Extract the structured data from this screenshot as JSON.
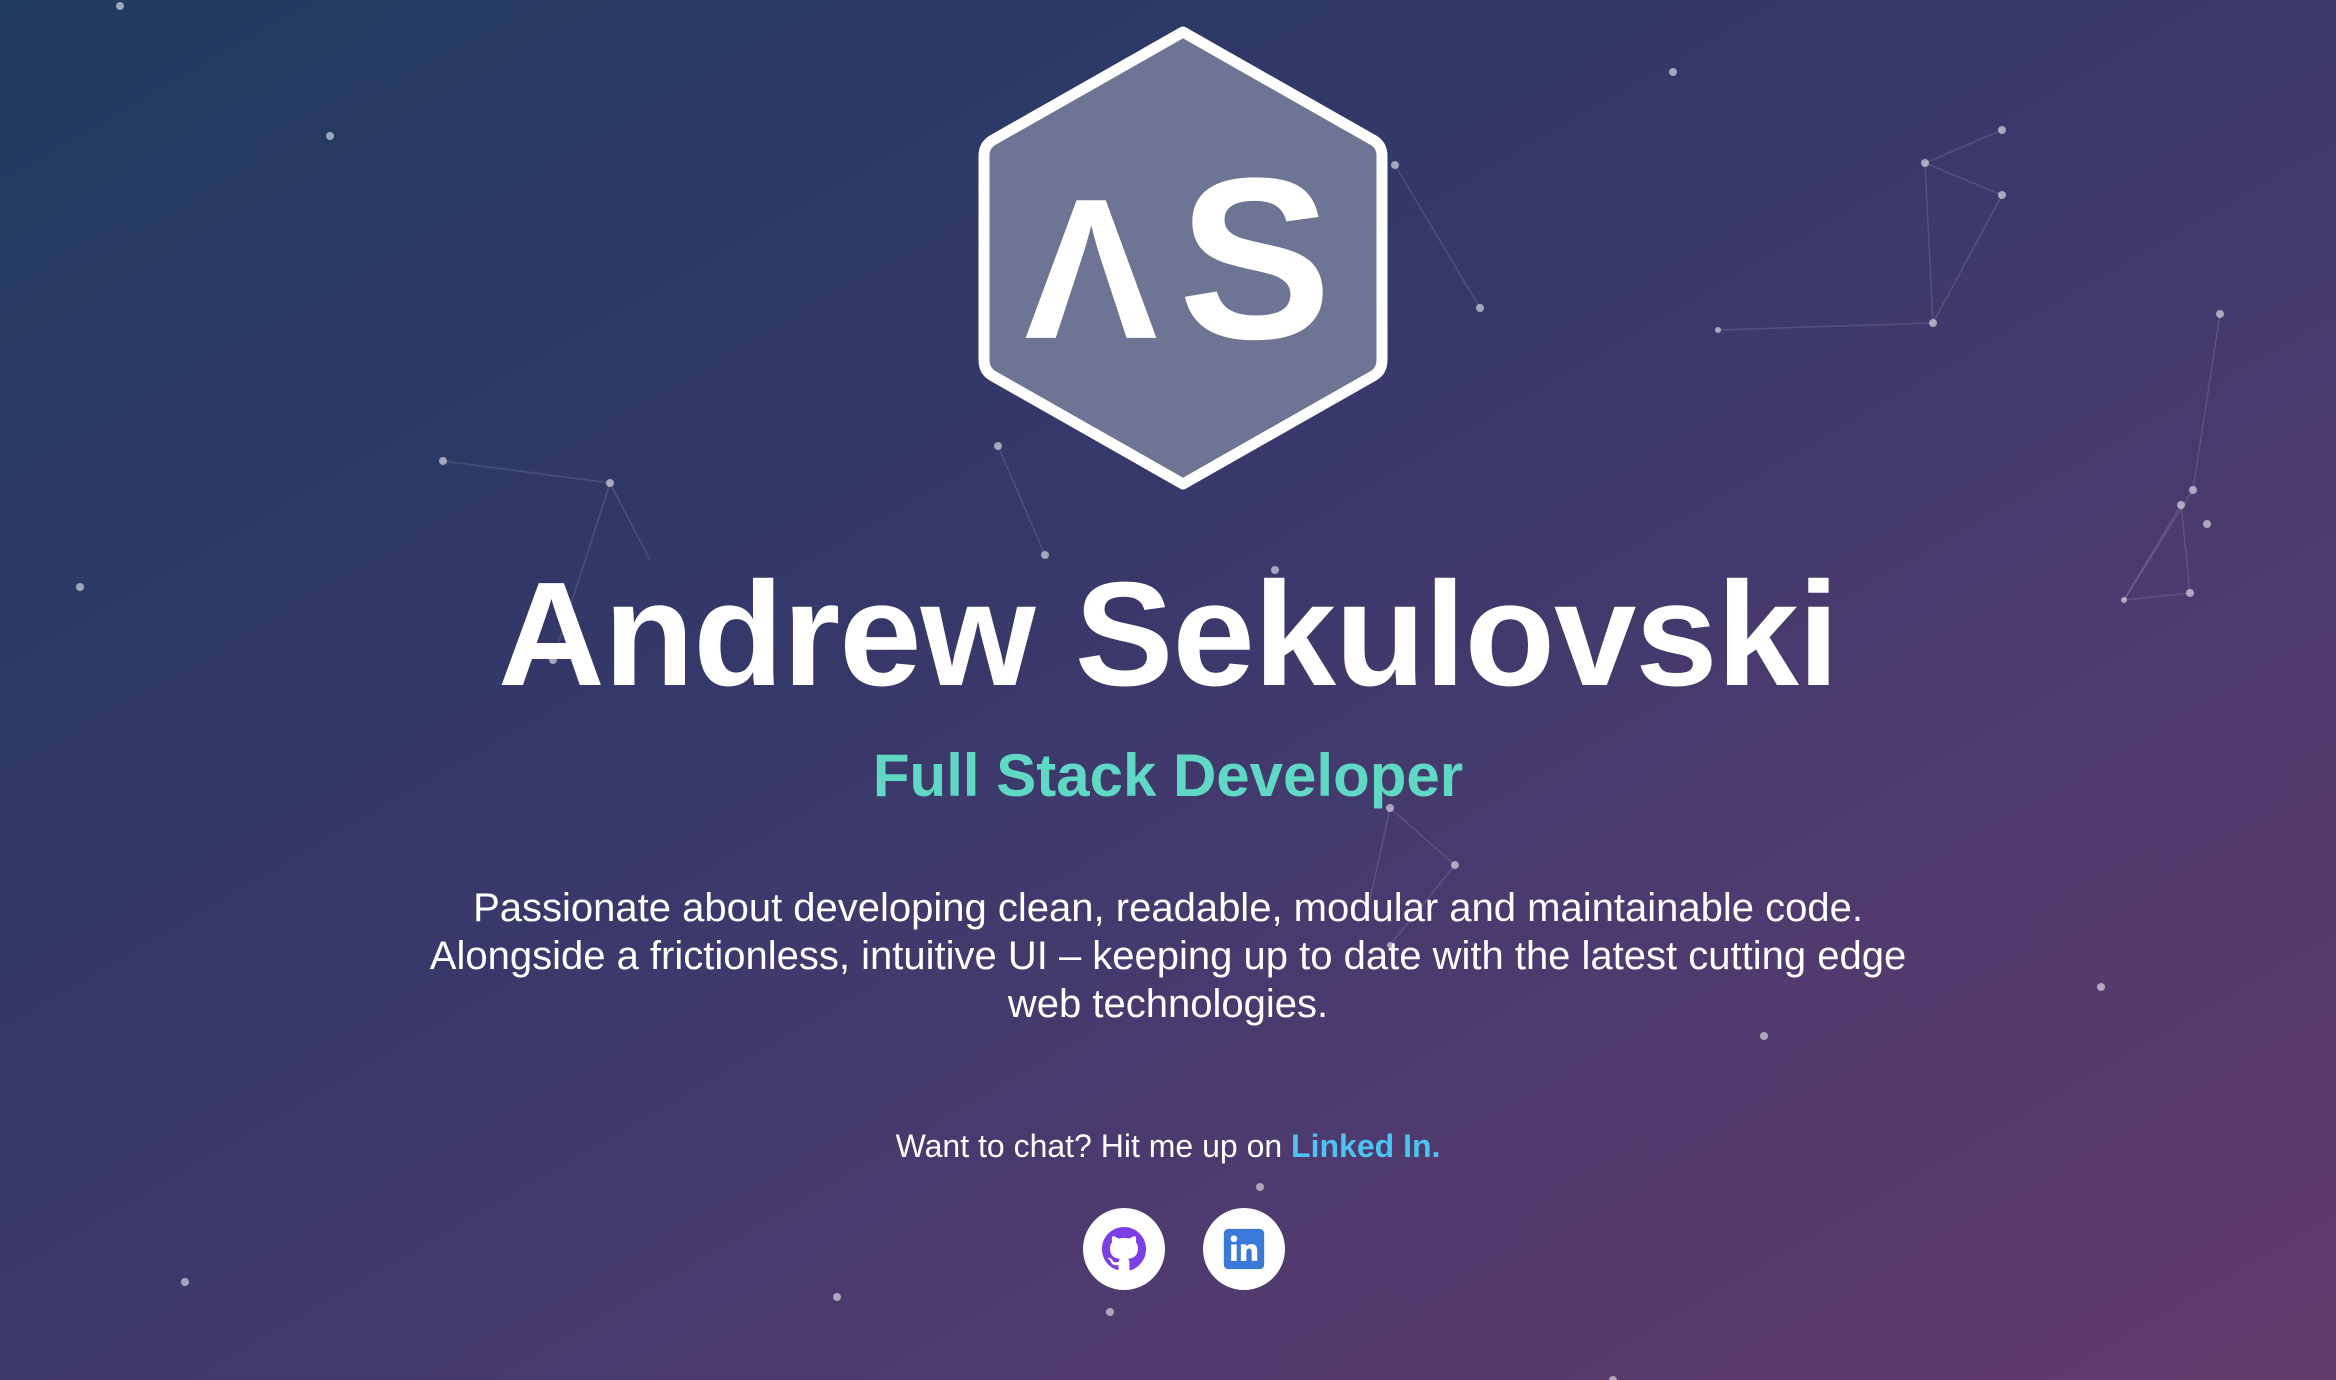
{
  "logo": {
    "initials_left": "Λ",
    "initials_right": "S",
    "icon": "AS-hexagon-logo"
  },
  "profile": {
    "name": "Andrew Sekulovski",
    "role": "Full Stack Developer",
    "bio_lines": [
      "Passionate about developing clean, readable, modular and maintainable code.",
      "Alongside a frictionless, intuitive UI – keeping up to date with the latest cutting edge",
      "web technologies."
    ]
  },
  "contact": {
    "prefix": "Want to chat? Hit me up on ",
    "link_label": "Linked In."
  },
  "social": [
    {
      "icon": "github-icon"
    },
    {
      "icon": "linkedin-icon"
    }
  ],
  "colors": {
    "accent_teal": "#5fd9c4",
    "link_blue": "#4cc3f0",
    "github_purple": "#7b3fe4",
    "linkedin_blue": "#3b79d8",
    "logo_fill": "#6e7594"
  }
}
